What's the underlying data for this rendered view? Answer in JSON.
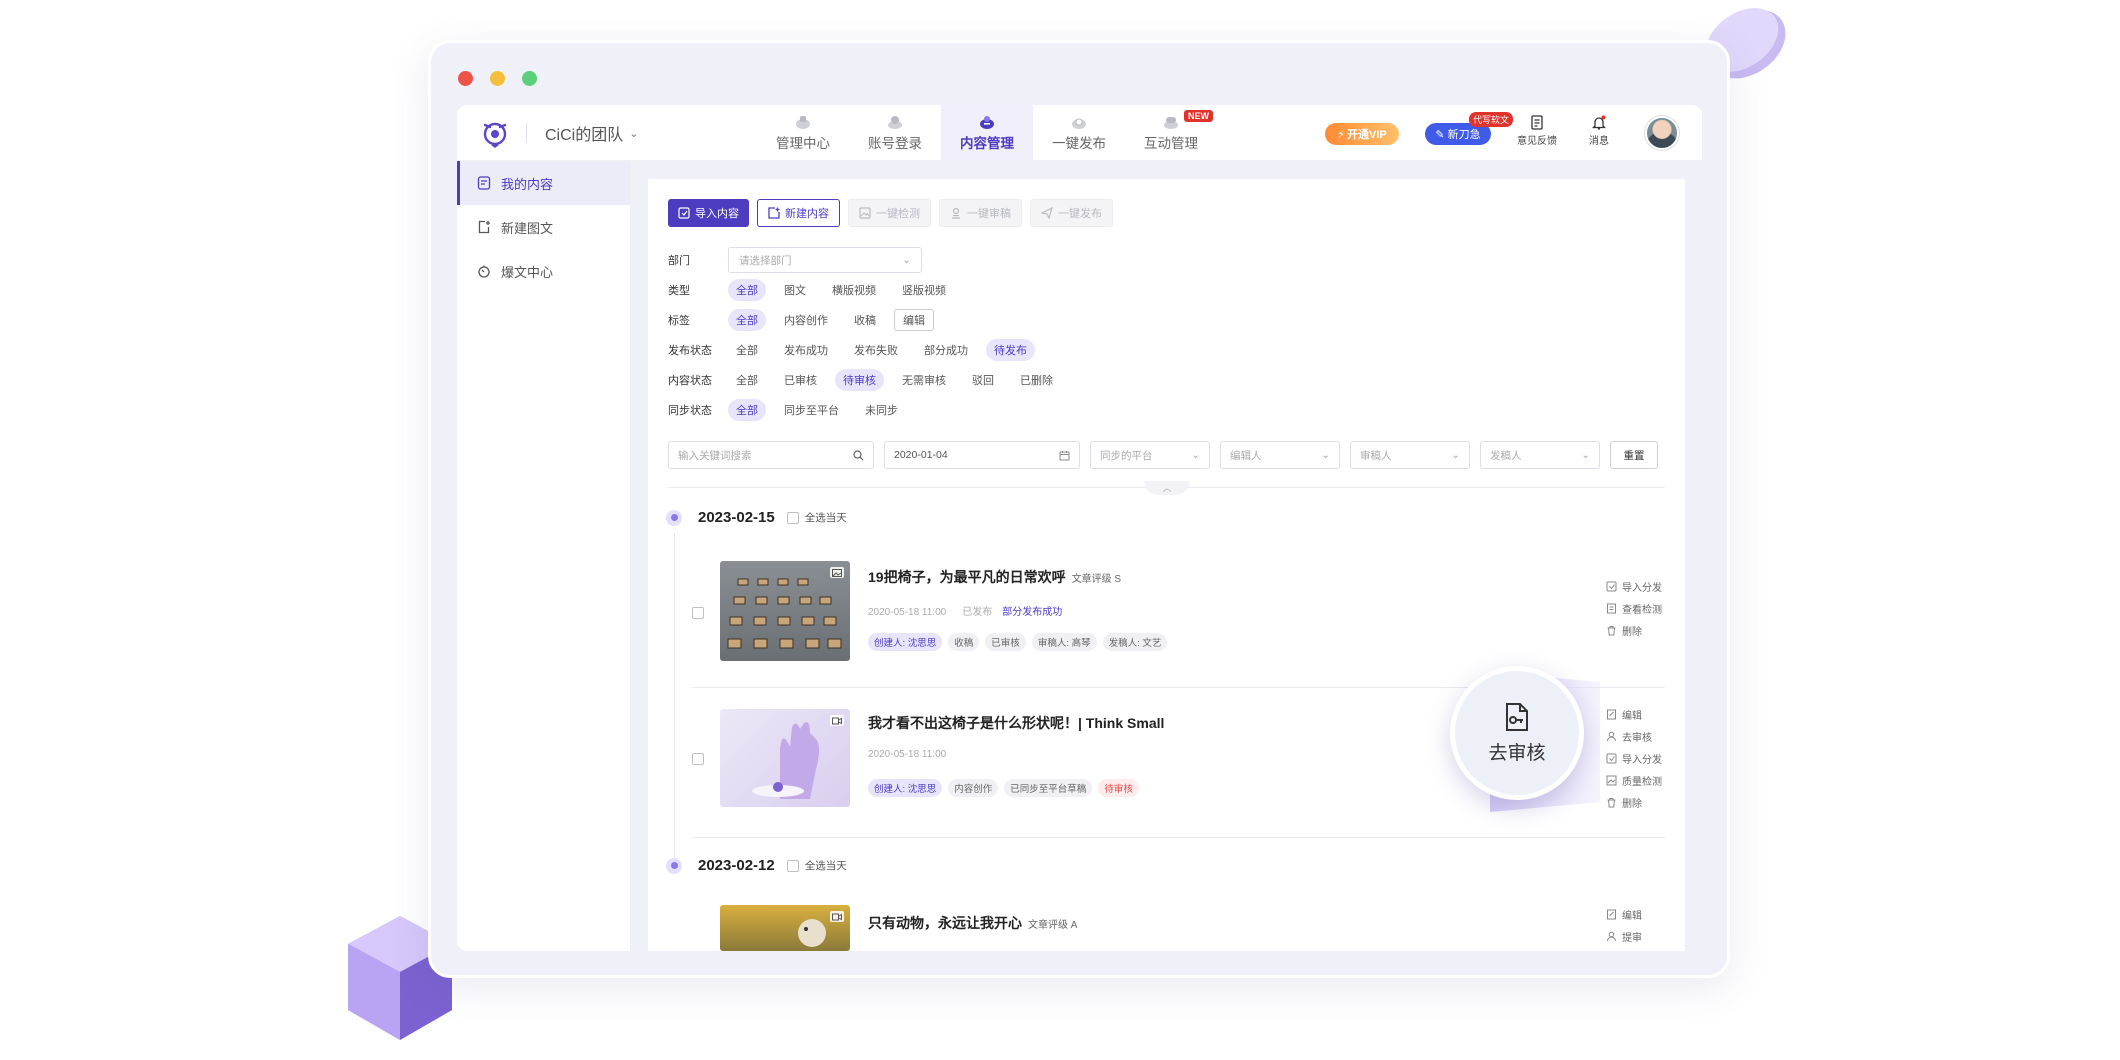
{
  "topbar": {
    "team_name": "CiCi的团队",
    "nav": [
      {
        "label": "管理中心",
        "icon": "dashboard-icon"
      },
      {
        "label": "账号登录",
        "icon": "account-icon"
      },
      {
        "label": "内容管理",
        "icon": "content-icon",
        "active": true
      },
      {
        "label": "一键发布",
        "icon": "publish-icon"
      },
      {
        "label": "互动管理",
        "icon": "interaction-icon",
        "badge": "NEW"
      }
    ],
    "vip_label": "开通VIP",
    "new_button_label": "新刀急",
    "new_button_tag": "代写软文",
    "feedback_label": "意见反馈",
    "messages_label": "消息"
  },
  "sidebar": {
    "items": [
      {
        "label": "我的内容",
        "icon": "document-icon",
        "active": true
      },
      {
        "label": "新建图文",
        "icon": "new-article-icon"
      },
      {
        "label": "爆文中心",
        "icon": "fire-icon"
      }
    ]
  },
  "toolbar": {
    "import_label": "导入内容",
    "new_label": "新建内容",
    "detect_label": "一键检测",
    "review_label": "一键审稿",
    "publish_label": "一键发布"
  },
  "filters": {
    "dept": {
      "label": "部门",
      "placeholder": "请选择部门"
    },
    "type": {
      "label": "类型",
      "options": [
        "全部",
        "图文",
        "横版视频",
        "竖版视频"
      ],
      "selected": "全部"
    },
    "tag": {
      "label": "标签",
      "options": [
        "全部",
        "内容创作",
        "收稿"
      ],
      "selected": "全部",
      "edit_label": "编辑"
    },
    "publish_status": {
      "label": "发布状态",
      "options": [
        "全部",
        "发布成功",
        "发布失败",
        "部分成功",
        "待发布"
      ],
      "selected": "待发布"
    },
    "content_status": {
      "label": "内容状态",
      "options": [
        "全部",
        "已审核",
        "待审核",
        "无需审核",
        "驳回",
        "已删除"
      ],
      "selected": "待审核"
    },
    "sync_status": {
      "label": "同步状态",
      "options": [
        "全部",
        "同步至平台",
        "未同步"
      ],
      "selected": "全部"
    }
  },
  "search": {
    "keyword_placeholder": "输入关键词搜索",
    "date_value": "2020-01-04",
    "platform_placeholder": "同步的平台",
    "editor_placeholder": "编辑人",
    "reviewer_placeholder": "审稿人",
    "sender_placeholder": "发稿人",
    "reset_label": "重置"
  },
  "groups": [
    {
      "date": "2023-02-15",
      "select_day_label": "全选当天",
      "items": [
        {
          "title": "19把椅子，为最平凡的日常欢呼",
          "grade": "文章评级 S",
          "time": "2020-05-18 11:00",
          "status": "已发布",
          "publish_result": "部分发布成功",
          "tags": [
            "创建人: 沈思思",
            "收稿",
            "已审核",
            "审稿人: 高琴",
            "发稿人: 文艺"
          ],
          "ops": [
            "导入分发",
            "查看检测",
            "删除"
          ]
        },
        {
          "title": "我才看不出这椅子是什么形状呢！| Think Small",
          "time": "2020-05-18 11:00",
          "tags": [
            "创建人: 沈思思",
            "内容创作",
            "已同步至平台草稿",
            "待审核"
          ],
          "ops": [
            "编辑",
            "去审核",
            "导入分发",
            "质量检测",
            "删除"
          ]
        }
      ]
    },
    {
      "date": "2023-02-12",
      "select_day_label": "全选当天",
      "items": [
        {
          "title": "只有动物，永远让我开心",
          "grade": "文章评级 A",
          "ops": [
            "编辑",
            "提审"
          ]
        }
      ]
    }
  ],
  "magnifier": {
    "label": "去审核",
    "icon": "document-key-icon"
  },
  "colors": {
    "accent": "#4b3cc0",
    "accent_light": "#e8e5fb",
    "vip": "#ff8a34",
    "new_button": "#3f5be8",
    "danger": "#e24d4d"
  }
}
